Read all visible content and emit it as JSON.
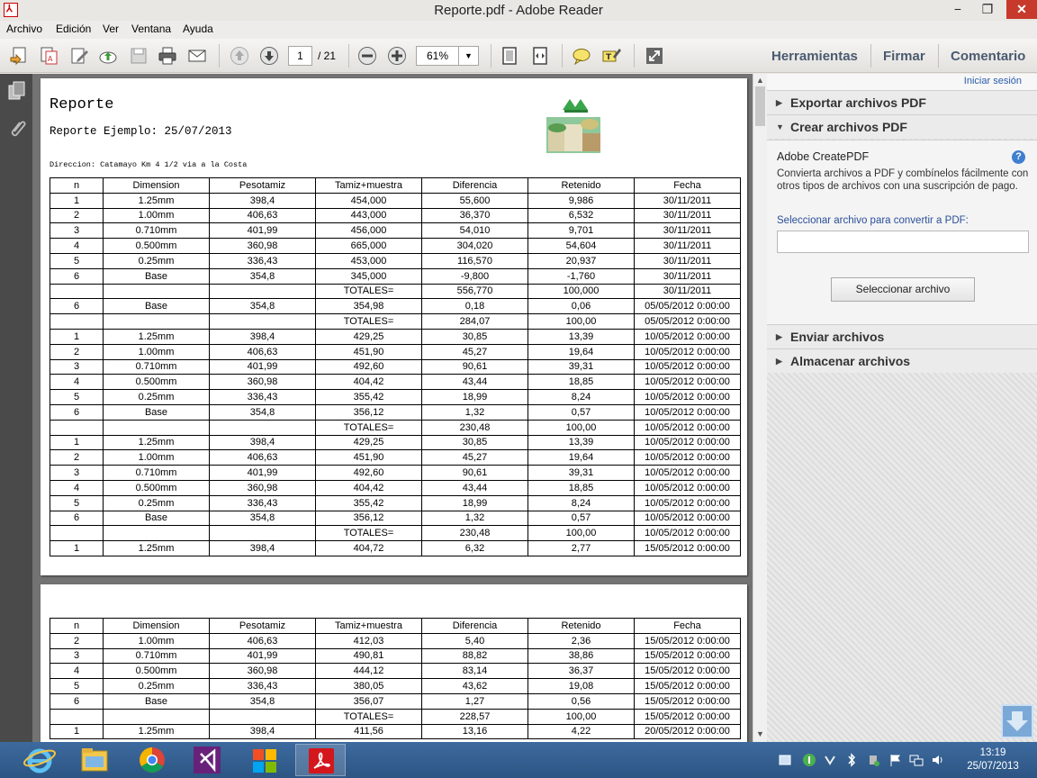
{
  "window": {
    "title": "Reporte.pdf - Adobe Reader",
    "minimize": "−",
    "restore": "❐",
    "close": "✕"
  },
  "menu": [
    "Archivo",
    "Edición",
    "Ver",
    "Ventana",
    "Ayuda"
  ],
  "toolbar": {
    "page_current": "1",
    "page_total": "/ 21",
    "zoom": "61%",
    "tools_label": "Herramientas",
    "sign_label": "Firmar",
    "comment_label": "Comentario"
  },
  "document": {
    "title": "Reporte",
    "subtitle": "Reporte Ejemplo: 25/07/2013",
    "address": "Direccion: Catamayo Km 4 1/2 via a la Costa",
    "columns": [
      "n",
      "Dimension",
      "Pesotamiz",
      "Tamiz+muestra",
      "Diferencia",
      "Retenido",
      "Fecha"
    ],
    "page1_rows": [
      [
        "1",
        "1.25mm",
        "398,4",
        "454,000",
        "55,600",
        "9,986",
        "30/11/2011"
      ],
      [
        "2",
        "1.00mm",
        "406,63",
        "443,000",
        "36,370",
        "6,532",
        "30/11/2011"
      ],
      [
        "3",
        "0.710mm",
        "401,99",
        "456,000",
        "54,010",
        "9,701",
        "30/11/2011"
      ],
      [
        "4",
        "0.500mm",
        "360,98",
        "665,000",
        "304,020",
        "54,604",
        "30/11/2011"
      ],
      [
        "5",
        "0.25mm",
        "336,43",
        "453,000",
        "116,570",
        "20,937",
        "30/11/2011"
      ],
      [
        "6",
        "Base",
        "354,8",
        "345,000",
        "-9,800",
        "-1,760",
        "30/11/2011"
      ],
      [
        "",
        "",
        "",
        "TOTALES=",
        "556,770",
        "100,000",
        "30/11/2011"
      ],
      [
        "6",
        "Base",
        "354,8",
        "354,98",
        "0,18",
        "0,06",
        "05/05/2012 0:00:00"
      ],
      [
        "",
        "",
        "",
        "TOTALES=",
        "284,07",
        "100,00",
        "05/05/2012 0:00:00"
      ],
      [
        "1",
        "1.25mm",
        "398,4",
        "429,25",
        "30,85",
        "13,39",
        "10/05/2012 0:00:00"
      ],
      [
        "2",
        "1.00mm",
        "406,63",
        "451,90",
        "45,27",
        "19,64",
        "10/05/2012 0:00:00"
      ],
      [
        "3",
        "0.710mm",
        "401,99",
        "492,60",
        "90,61",
        "39,31",
        "10/05/2012 0:00:00"
      ],
      [
        "4",
        "0.500mm",
        "360,98",
        "404,42",
        "43,44",
        "18,85",
        "10/05/2012 0:00:00"
      ],
      [
        "5",
        "0.25mm",
        "336,43",
        "355,42",
        "18,99",
        "8,24",
        "10/05/2012 0:00:00"
      ],
      [
        "6",
        "Base",
        "354,8",
        "356,12",
        "1,32",
        "0,57",
        "10/05/2012 0:00:00"
      ],
      [
        "",
        "",
        "",
        "TOTALES=",
        "230,48",
        "100,00",
        "10/05/2012 0:00:00"
      ],
      [
        "1",
        "1.25mm",
        "398,4",
        "429,25",
        "30,85",
        "13,39",
        "10/05/2012 0:00:00"
      ],
      [
        "2",
        "1.00mm",
        "406,63",
        "451,90",
        "45,27",
        "19,64",
        "10/05/2012 0:00:00"
      ],
      [
        "3",
        "0.710mm",
        "401,99",
        "492,60",
        "90,61",
        "39,31",
        "10/05/2012 0:00:00"
      ],
      [
        "4",
        "0.500mm",
        "360,98",
        "404,42",
        "43,44",
        "18,85",
        "10/05/2012 0:00:00"
      ],
      [
        "5",
        "0.25mm",
        "336,43",
        "355,42",
        "18,99",
        "8,24",
        "10/05/2012 0:00:00"
      ],
      [
        "6",
        "Base",
        "354,8",
        "356,12",
        "1,32",
        "0,57",
        "10/05/2012 0:00:00"
      ],
      [
        "",
        "",
        "",
        "TOTALES=",
        "230,48",
        "100,00",
        "10/05/2012 0:00:00"
      ],
      [
        "1",
        "1.25mm",
        "398,4",
        "404,72",
        "6,32",
        "2,77",
        "15/05/2012 0:00:00"
      ]
    ],
    "page2_rows": [
      [
        "2",
        "1.00mm",
        "406,63",
        "412,03",
        "5,40",
        "2,36",
        "15/05/2012 0:00:00"
      ],
      [
        "3",
        "0.710mm",
        "401,99",
        "490,81",
        "88,82",
        "38,86",
        "15/05/2012 0:00:00"
      ],
      [
        "4",
        "0.500mm",
        "360,98",
        "444,12",
        "83,14",
        "36,37",
        "15/05/2012 0:00:00"
      ],
      [
        "5",
        "0.25mm",
        "336,43",
        "380,05",
        "43,62",
        "19,08",
        "15/05/2012 0:00:00"
      ],
      [
        "6",
        "Base",
        "354,8",
        "356,07",
        "1,27",
        "0,56",
        "15/05/2012 0:00:00"
      ],
      [
        "",
        "",
        "",
        "TOTALES=",
        "228,57",
        "100,00",
        "15/05/2012 0:00:00"
      ],
      [
        "1",
        "1.25mm",
        "398,4",
        "411,56",
        "13,16",
        "4,22",
        "20/05/2012 0:00:00"
      ]
    ]
  },
  "right_pane": {
    "login": "Iniciar sesión",
    "export_pdf": "Exportar archivos PDF",
    "create_pdf": "Crear archivos PDF",
    "createpdf_heading": "Adobe CreatePDF",
    "createpdf_desc": "Convierta archivos a PDF y combínelos fácilmente con otros tipos de archivos con una suscripción de pago.",
    "select_file_label": "Seleccionar archivo para convertir a PDF:",
    "select_file_button": "Seleccionar archivo",
    "send_files": "Enviar archivos",
    "store_files": "Almacenar archivos"
  },
  "taskbar": {
    "time": "13:19",
    "date": "25/07/2013"
  },
  "colors": {
    "accent": "#2a5caa",
    "close": "#c7392b",
    "taskbar": "#2c5583"
  }
}
